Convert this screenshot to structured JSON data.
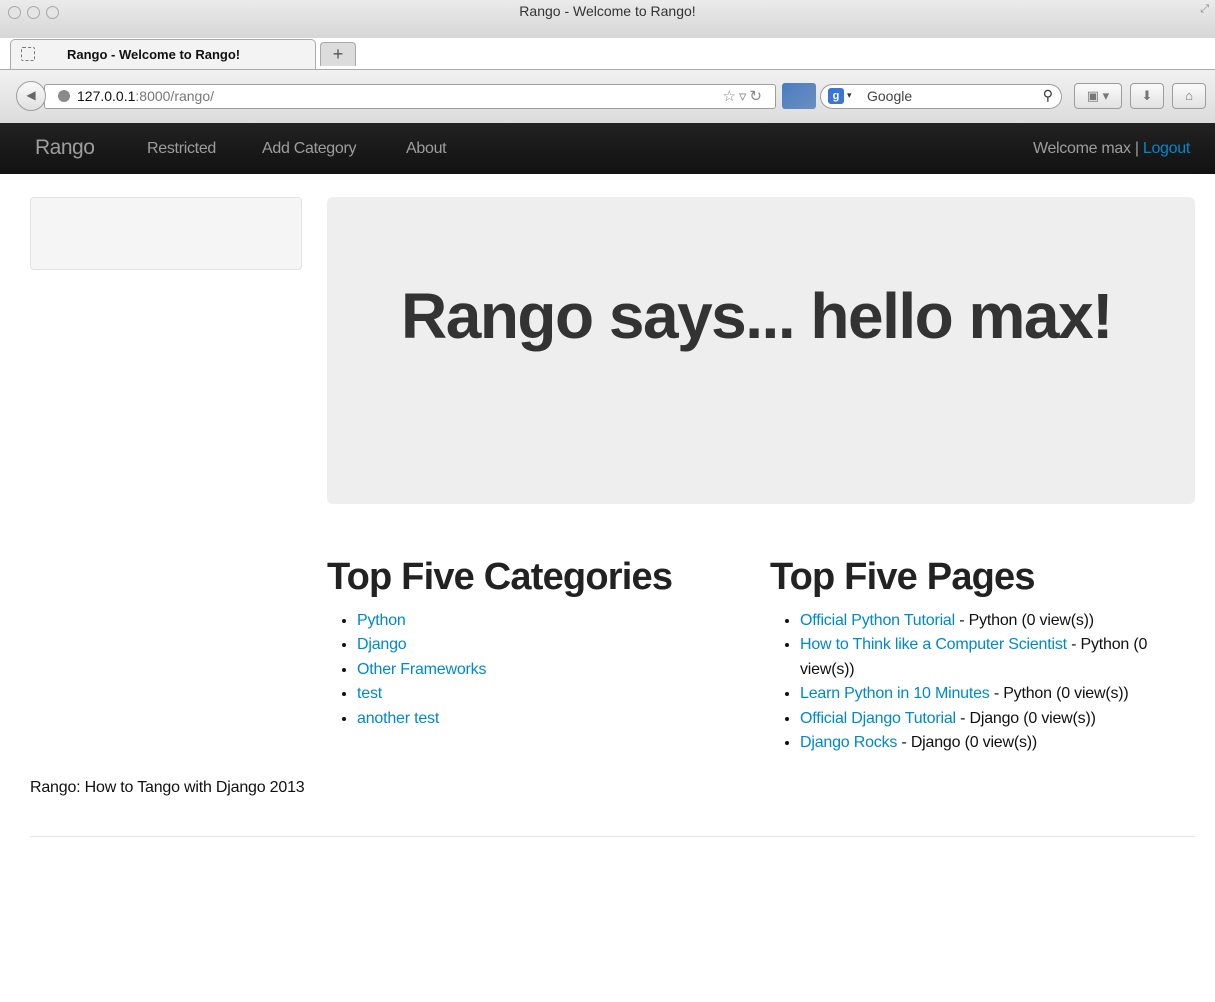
{
  "window": {
    "title": "Rango - Welcome to Rango!"
  },
  "tab": {
    "title": "Rango - Welcome to Rango!",
    "new_tab": "+"
  },
  "toolbar": {
    "url_host": "127.0.0.1",
    "url_rest": ":8000/rango/",
    "search_placeholder": "Google"
  },
  "navbar": {
    "brand": "Rango",
    "links": [
      "Restricted",
      "Add Category",
      "About"
    ],
    "welcome": "Welcome max",
    "separator": " | ",
    "logout": "Logout"
  },
  "hero": {
    "heading": "Rango says... hello max!"
  },
  "categories": {
    "heading": "Top Five Categories",
    "items": [
      "Python",
      "Django",
      "Other Frameworks",
      "test",
      "another test"
    ]
  },
  "pages": {
    "heading": "Top Five Pages",
    "items": [
      {
        "title": "Official Python Tutorial",
        "detail": " - Python (0 view(s))"
      },
      {
        "title": "How to Think like a Computer Scientist",
        "detail": " - Python (0 view(s))"
      },
      {
        "title": "Learn Python in 10 Minutes",
        "detail": " - Python (0 view(s))"
      },
      {
        "title": "Official Django Tutorial",
        "detail": " - Django (0 view(s))"
      },
      {
        "title": "Django Rocks",
        "detail": " - Django (0 view(s))"
      }
    ]
  },
  "footer": {
    "text": "Rango: How to Tango with Django 2013"
  },
  "colors": {
    "link": "#0088cc",
    "navbar": "#1b1b1b",
    "hero": "#eeeeee"
  }
}
